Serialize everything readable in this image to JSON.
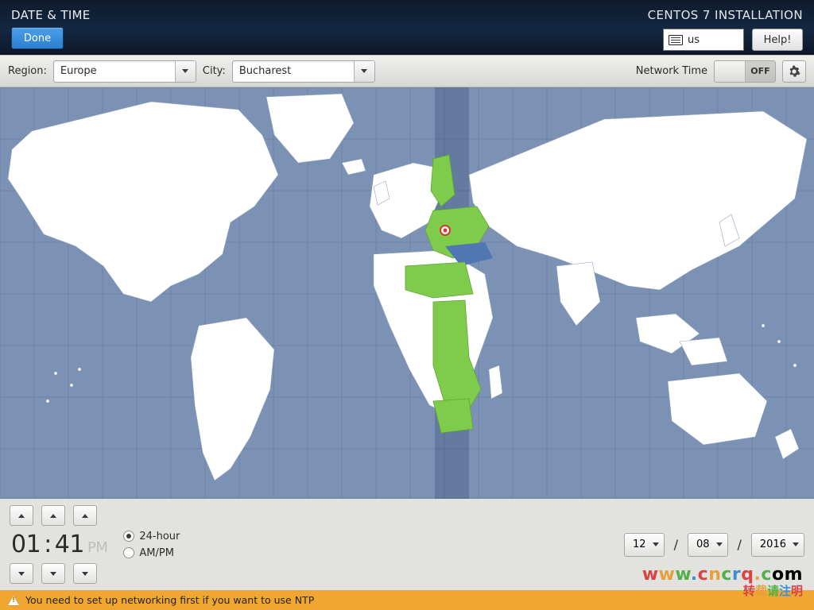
{
  "header": {
    "title": "DATE & TIME",
    "done_label": "Done",
    "install_title": "CENTOS 7 INSTALLATION",
    "kbd_layout": "us",
    "help_label": "Help!"
  },
  "toolbar": {
    "region_label": "Region:",
    "region_value": "Europe",
    "city_label": "City:",
    "city_value": "Bucharest",
    "network_time_label": "Network Time",
    "network_time_state": "OFF"
  },
  "time": {
    "hour": "01",
    "minute": "41",
    "ampm": "PM",
    "format_24h_label": "24-hour",
    "format_ampm_label": "AM/PM",
    "format_selected": "24-hour"
  },
  "date": {
    "month": "12",
    "day": "08",
    "year": "2016"
  },
  "warning": {
    "text": "You need to set up networking first if you want to use NTP"
  },
  "watermark": {
    "main": "www.cncrq.com",
    "sub": "转载请注明"
  }
}
